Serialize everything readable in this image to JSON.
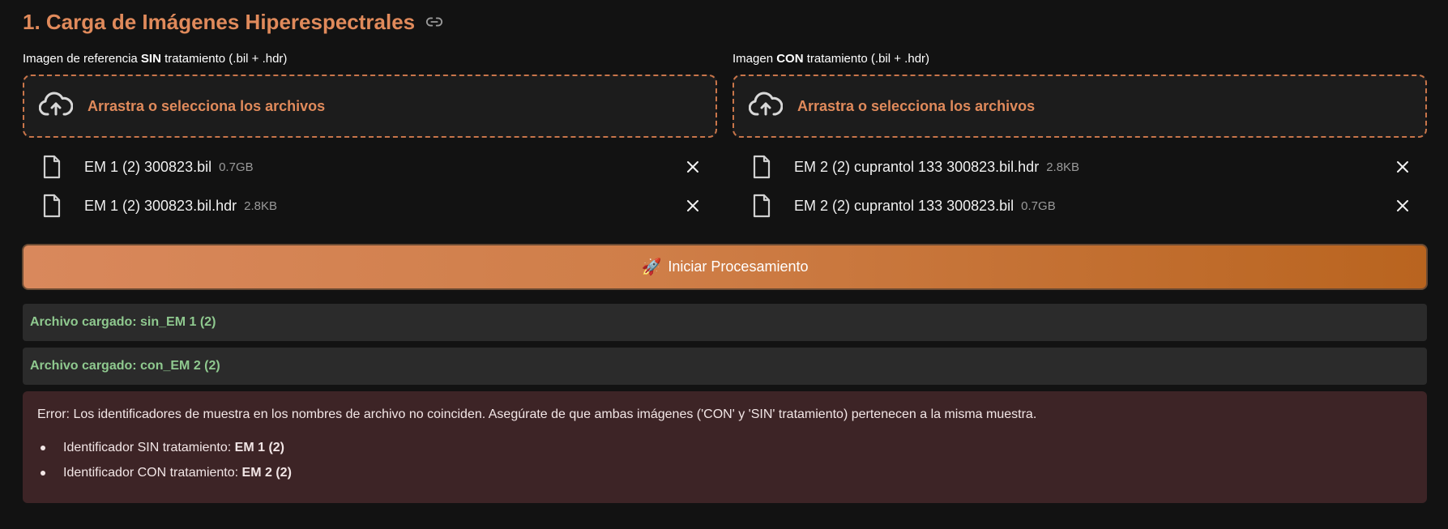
{
  "section": {
    "title": "1. Carga de Imágenes Hiperespectrales",
    "link_icon": "link-icon"
  },
  "uploaders": [
    {
      "label_prefix": "Imagen de referencia ",
      "label_bold": "SIN",
      "label_suffix": " tratamiento (.bil + .hdr)",
      "dropzone_text": "Arrastra o selecciona los archivos",
      "files": [
        {
          "name": "EM 1 (2) 300823.bil",
          "size": "0.7GB"
        },
        {
          "name": "EM 1 (2) 300823.bil.hdr",
          "size": "2.8KB"
        }
      ]
    },
    {
      "label_prefix": "Imagen ",
      "label_bold": "CON",
      "label_suffix": " tratamiento (.bil + .hdr)",
      "dropzone_text": "Arrastra o selecciona los archivos",
      "files": [
        {
          "name": "EM 2 (2) cuprantol 133 300823.bil.hdr",
          "size": "2.8KB"
        },
        {
          "name": "EM 2 (2) cuprantol 133 300823.bil",
          "size": "0.7GB"
        }
      ]
    }
  ],
  "start_button": {
    "icon": "🚀",
    "label": "Iniciar Procesamiento"
  },
  "status": [
    "Archivo cargado: sin_EM 1 (2)",
    "Archivo cargado: con_EM 2 (2)"
  ],
  "error": {
    "message": "Error: Los identificadores de muestra en los nombres de archivo no coinciden. Asegúrate de que ambas imágenes ('CON' y 'SIN' tratamiento) pertenecen a la misma muestra.",
    "items": [
      {
        "label": "Identificador SIN tratamiento: ",
        "value": "EM 1 (2)"
      },
      {
        "label": "Identificador CON tratamiento: ",
        "value": "EM 2 (2)"
      }
    ]
  },
  "colors": {
    "accent": "#e08a5b",
    "background": "#121212",
    "success_text": "#8fc98f",
    "error_bg": "#3d2426"
  }
}
